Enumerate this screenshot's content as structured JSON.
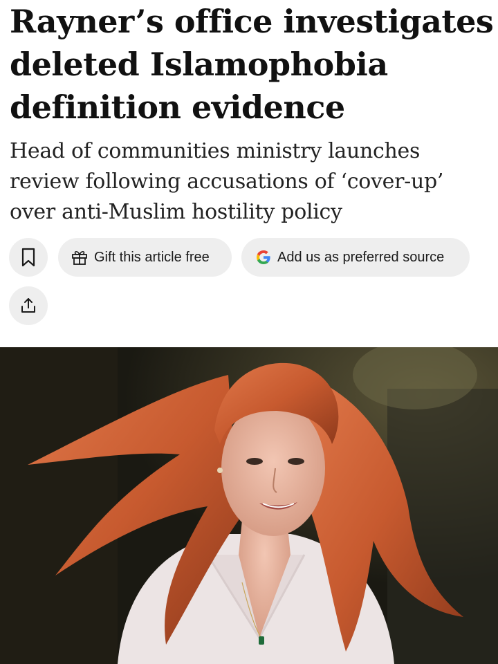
{
  "article": {
    "headline": "Rayner’s office investigates deleted Islamophobia definition evidence",
    "standfirst": "Head of communities ministry launches review following accusations of ‘cover-up’ over anti-Muslim hostility policy"
  },
  "actions": {
    "bookmark_icon": "bookmark-icon",
    "gift_icon": "gift-icon",
    "gift_label": "Gift this article free",
    "google_icon": "google-g-icon",
    "source_label": "Add us as preferred source",
    "share_icon": "share-icon"
  },
  "colors": {
    "button_bg": "#eeeeee",
    "text": "#111111",
    "google_blue": "#4285F4",
    "google_red": "#EA4335",
    "google_yellow": "#FBBC05",
    "google_green": "#34A853"
  },
  "hero_image": {
    "icon": "photo-of-woman-with-red-hair"
  }
}
